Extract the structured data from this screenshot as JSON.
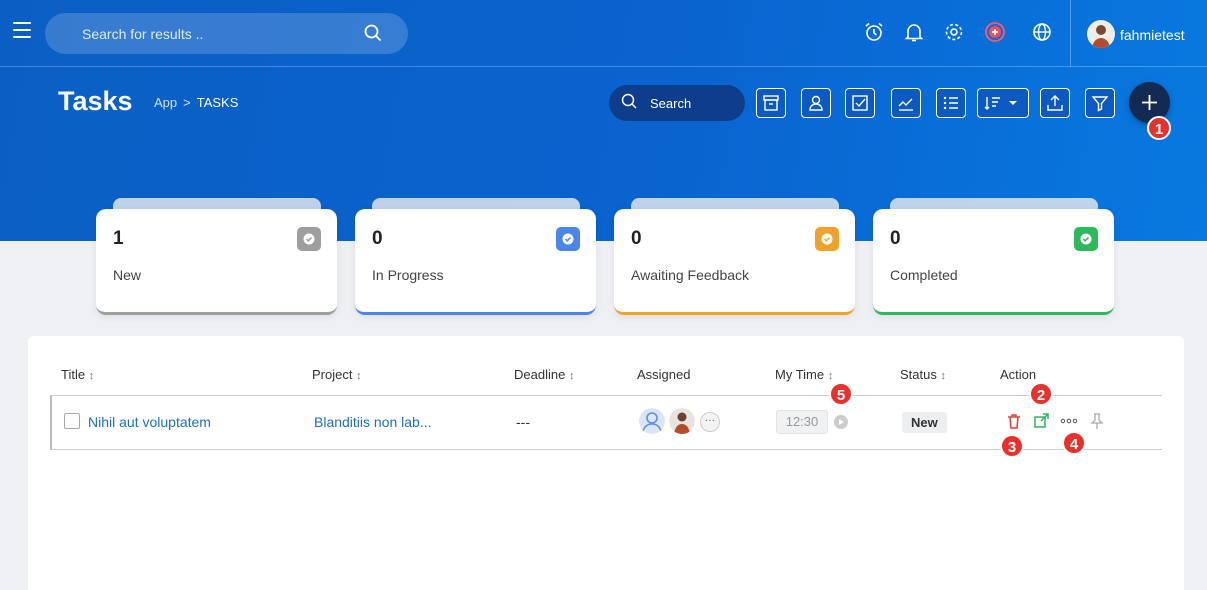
{
  "topbar": {
    "search_placeholder": "Search for results ..",
    "icons": [
      "alarm-clock-icon",
      "bell-icon",
      "gear-icon",
      "add-circle-icon",
      "globe-icon"
    ],
    "username": "fahmietest"
  },
  "page": {
    "title": "Tasks",
    "breadcrumb": {
      "root": "App",
      "sep": ">",
      "current": "TASKS"
    }
  },
  "toolbar": {
    "search_label": "Search",
    "buttons": [
      "archive-icon",
      "user-icon",
      "checkbox-icon",
      "chart-line-icon",
      "list-icon",
      "sort-dropdown-icon",
      "upload-icon",
      "filter-icon"
    ],
    "add_button": "plus-icon"
  },
  "stats": [
    {
      "count": "1",
      "label": "New",
      "color": "#9e9e9e"
    },
    {
      "count": "0",
      "label": "In Progress",
      "color": "#4a86e8"
    },
    {
      "count": "0",
      "label": "Awaiting Feedback",
      "color": "#f0a32c"
    },
    {
      "count": "0",
      "label": "Completed",
      "color": "#2eb85c"
    }
  ],
  "table": {
    "headers": {
      "title": "Title",
      "project": "Project",
      "deadline": "Deadline",
      "assigned": "Assigned",
      "mytime": "My Time",
      "status": "Status",
      "action": "Action"
    },
    "sort_glyph": "↕",
    "rows": [
      {
        "title": "Nihil aut voluptatem",
        "project": "Blanditiis non lab...",
        "deadline": "---",
        "time": "12:30",
        "status": "New",
        "more": "···"
      }
    ]
  },
  "annotations": [
    "1",
    "2",
    "3",
    "4",
    "5"
  ]
}
